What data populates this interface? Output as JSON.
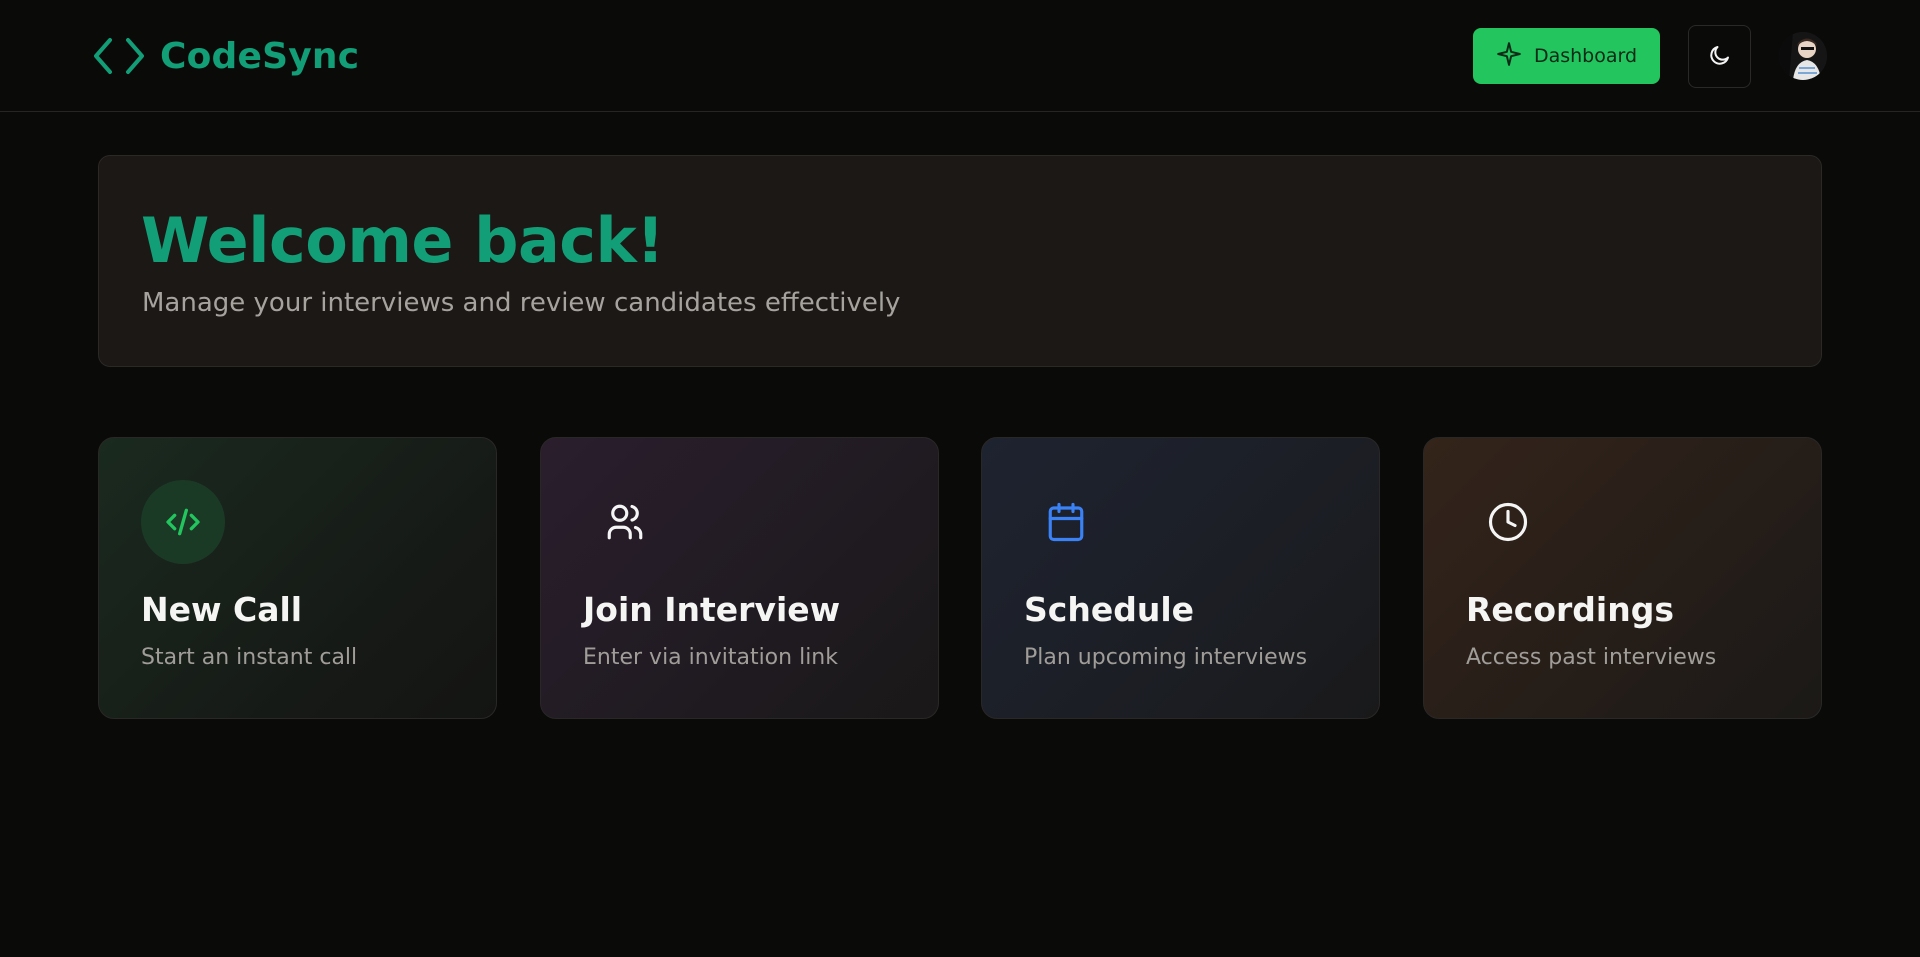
{
  "navbar": {
    "brand_name": "CodeSync",
    "brand_icon": "code-brackets-icon",
    "dashboard_label": "Dashboard",
    "dashboard_icon": "sparkle-icon",
    "theme_icon": "moon-icon",
    "avatar_icon": "user-avatar"
  },
  "welcome": {
    "title": "Welcome back!",
    "subtitle": "Manage your interviews and review candidates effectively"
  },
  "actions": [
    {
      "title": "New Call",
      "description": "Start an instant call",
      "icon": "code-icon",
      "color": "#22c55e"
    },
    {
      "title": "Join Interview",
      "description": "Enter via invitation link",
      "icon": "users-icon",
      "color": "#f5f5f5"
    },
    {
      "title": "Schedule",
      "description": "Plan upcoming interviews",
      "icon": "calendar-icon",
      "color": "#3b82f6"
    },
    {
      "title": "Recordings",
      "description": "Access past interviews",
      "icon": "clock-icon",
      "color": "#f5f5f5"
    }
  ],
  "colors": {
    "accent": "#129e77",
    "primary_button": "#22c55e",
    "background": "#0a0a09"
  }
}
